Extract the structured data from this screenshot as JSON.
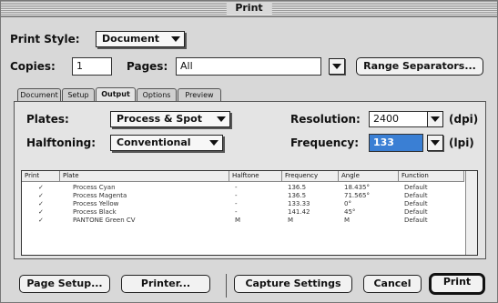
{
  "window": {
    "title": "Print"
  },
  "print_style": {
    "label": "Print Style:",
    "value": "Document"
  },
  "copies": {
    "label": "Copies:",
    "value": "1"
  },
  "pages": {
    "label": "Pages:",
    "value": "All"
  },
  "range_separators_label": "Range Separators...",
  "tabs": [
    {
      "label": "Document",
      "active": false
    },
    {
      "label": "Setup",
      "active": false
    },
    {
      "label": "Output",
      "active": true
    },
    {
      "label": "Options",
      "active": false
    },
    {
      "label": "Preview",
      "active": false
    }
  ],
  "output": {
    "plates_label": "Plates:",
    "plates_value": "Process & Spot",
    "halftoning_label": "Halftoning:",
    "halftoning_value": "Conventional",
    "resolution_label": "Resolution:",
    "resolution_value": "2400",
    "resolution_unit": "(dpi)",
    "frequency_label": "Frequency:",
    "frequency_value": "133",
    "frequency_unit": "(lpi)"
  },
  "table": {
    "headers": [
      "Print",
      "Plate",
      "Halftone",
      "Frequency",
      "Angle",
      "Function"
    ],
    "rows": [
      [
        "✓",
        "Process Cyan",
        "-",
        "136.5",
        "18.435°",
        "Default"
      ],
      [
        "✓",
        "Process Magenta",
        "-",
        "136.5",
        "71.565°",
        "Default"
      ],
      [
        "✓",
        "Process Yellow",
        "-",
        "133.33",
        "0°",
        "Default"
      ],
      [
        "✓",
        "Process Black",
        "-",
        "141.42",
        "45°",
        "Default"
      ],
      [
        "✓",
        "PANTONE Green CV",
        "M",
        "M",
        "M",
        "Default"
      ]
    ]
  },
  "buttons": {
    "page_setup": "Page Setup...",
    "printer": "Printer...",
    "capture_settings": "Capture Settings",
    "cancel": "Cancel",
    "print": "Print"
  }
}
